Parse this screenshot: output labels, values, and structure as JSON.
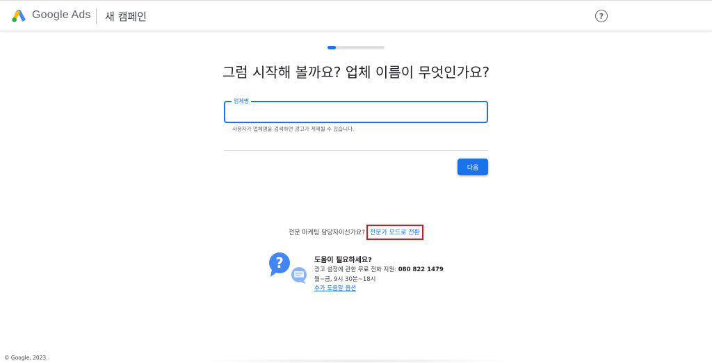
{
  "header": {
    "brand": "Google Ads",
    "page_title": "새 캠페인",
    "help_icon": "help-circle-icon",
    "help_symbol": "?"
  },
  "progress": {
    "fraction": 0.15
  },
  "main": {
    "headline": "그럼 시작해 볼까요? 업체 이름이 무엇인가요?",
    "business_field": {
      "label": "업체명",
      "value": "",
      "helper": "사용자가 업체명을 검색하면 광고가 게재될 수 있습니다."
    },
    "next_label": "다음"
  },
  "expert": {
    "question": "전문 마케팅 담당자이신가요?",
    "link": "전문가 모드로 전환"
  },
  "help": {
    "heading": "도움이 필요하세요?",
    "phone_prefix": "광고 설정에 관한 무료 전화 지원: ",
    "phone_number": "080 822 1479",
    "hours": "월~금, 9시 30분~18시",
    "more_link": "추가 도움말 옵션"
  },
  "footer": {
    "copyright": "© Google, 2023."
  },
  "colors": {
    "accent": "#1a73e8",
    "highlight_box": "#e2111b",
    "logo_yellow": "#fbbc04",
    "logo_blue": "#4285f4",
    "logo_green": "#34a853"
  }
}
